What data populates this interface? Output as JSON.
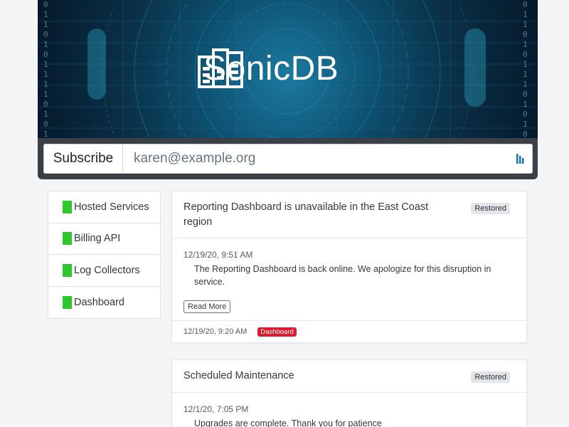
{
  "brand": {
    "name": "SonicDB",
    "icon": "database-bars-icon"
  },
  "banner": {
    "binary_left": "01101011110101",
    "binary_right": "0110101110101011"
  },
  "subscribe": {
    "button_label": "Subscribe",
    "placeholder": "karen@example.org",
    "icon": "password-manager-icon"
  },
  "sidebar": {
    "items": [
      {
        "label": "Hosted Services",
        "status": "operational",
        "status_color": "#2ec82e"
      },
      {
        "label": "Billing API",
        "status": "operational",
        "status_color": "#2ec82e"
      },
      {
        "label": "Log Collectors",
        "status": "operational",
        "status_color": "#2ec82e"
      },
      {
        "label": "Dashboard",
        "status": "operational",
        "status_color": "#2ec82e"
      }
    ]
  },
  "incidents": [
    {
      "title": "Reporting Dashboard is unavailable in the East Coast region",
      "badge": "Restored",
      "update_time": "12/19/20, 9:51 AM",
      "update_text": "The Reporting Dashboard is back online. We apologize for this disruption in service.",
      "read_more": "Read More",
      "started": "12/19/20, 9:20 AM",
      "component_tag": "Dashboard",
      "tag_color": "#dc1c2e"
    },
    {
      "title": "Scheduled Maintenance",
      "badge": "Restored",
      "update_time": "12/1/20, 7:05 PM",
      "update_text": "Upgrades are complete. Thank you for patience"
    }
  ]
}
